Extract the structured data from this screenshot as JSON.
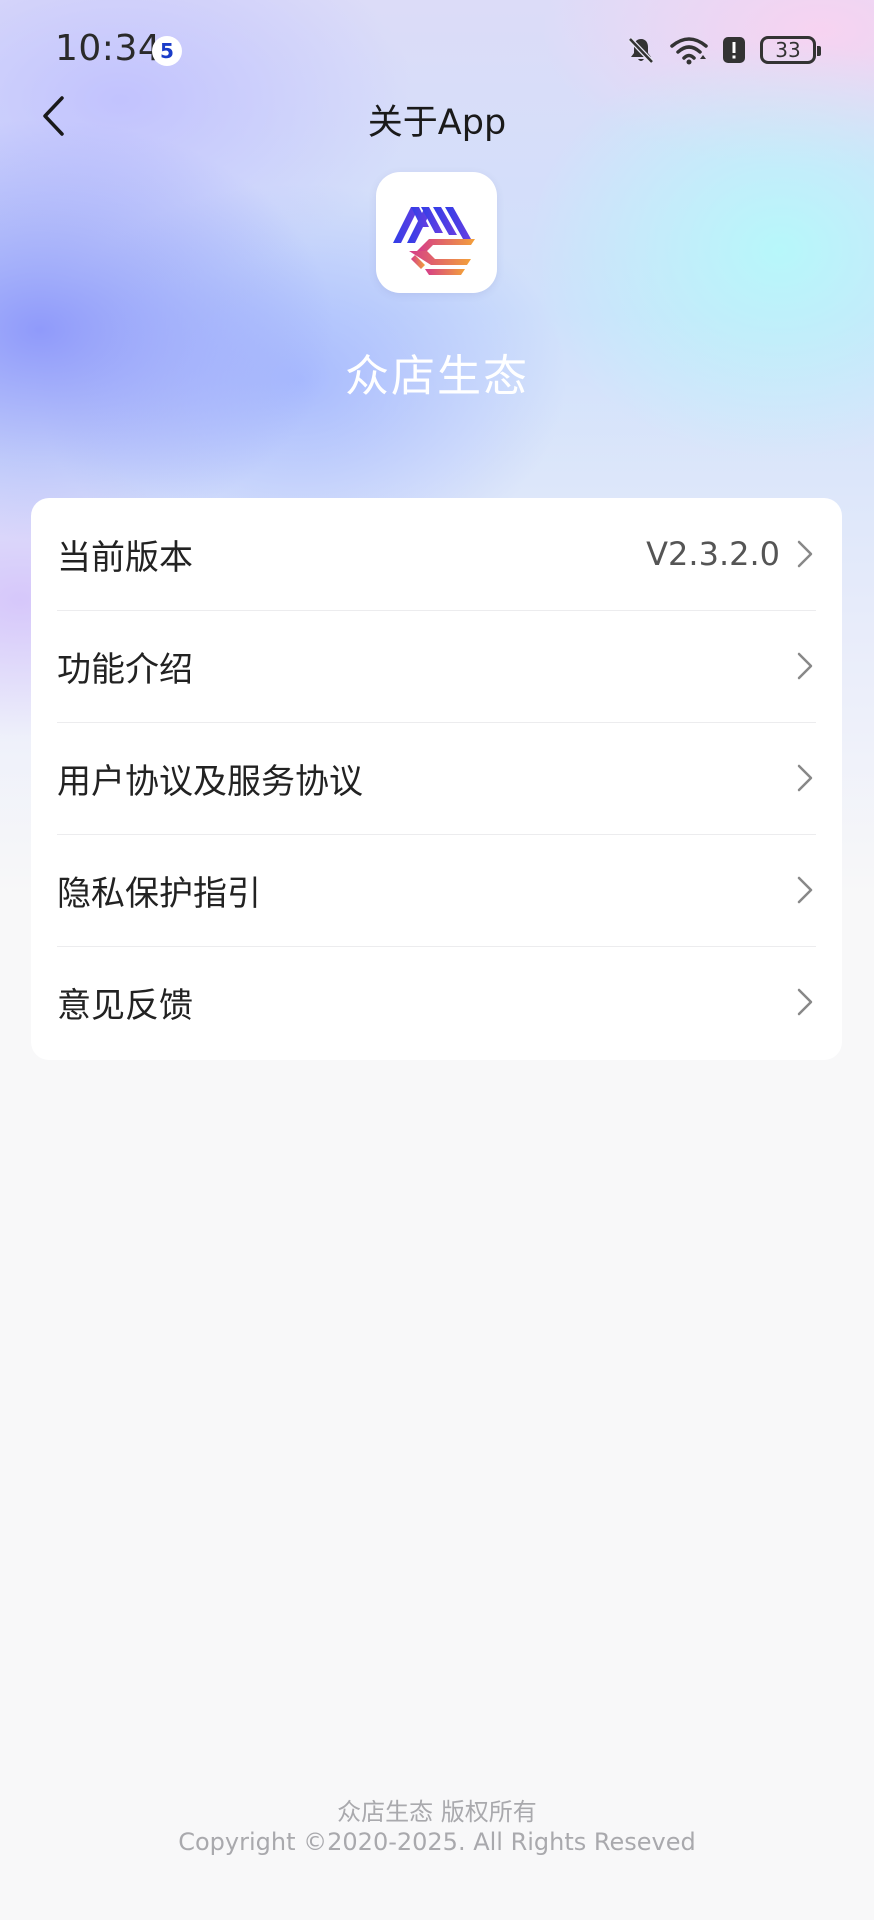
{
  "status_bar": {
    "time": "10:34",
    "app_badge": "5",
    "battery_level": "33",
    "icons": [
      "bell-muted-icon",
      "wifi-icon",
      "alert-icon",
      "battery-icon"
    ]
  },
  "nav": {
    "title": "关于App",
    "back_icon": "back-arrow-icon"
  },
  "app": {
    "name": "众店生态",
    "logo_icon": "app-logo-icon"
  },
  "menu": {
    "items": [
      {
        "label": "当前版本",
        "value": "V2.3.2.0"
      },
      {
        "label": "功能介绍",
        "value": ""
      },
      {
        "label": "用户协议及服务协议",
        "value": ""
      },
      {
        "label": "隐私保护指引",
        "value": ""
      },
      {
        "label": "意见反馈",
        "value": ""
      }
    ]
  },
  "footer": {
    "line1": "众店生态 版权所有",
    "line2": "Copyright ©2020-2025. All Rights Reseved"
  },
  "colors": {
    "card_background": "#ffffff",
    "page_background": "#f8f8f9",
    "logo_blue": "#3a3ae0",
    "logo_pink": "#e0508a",
    "logo_orange": "#f0a040"
  }
}
